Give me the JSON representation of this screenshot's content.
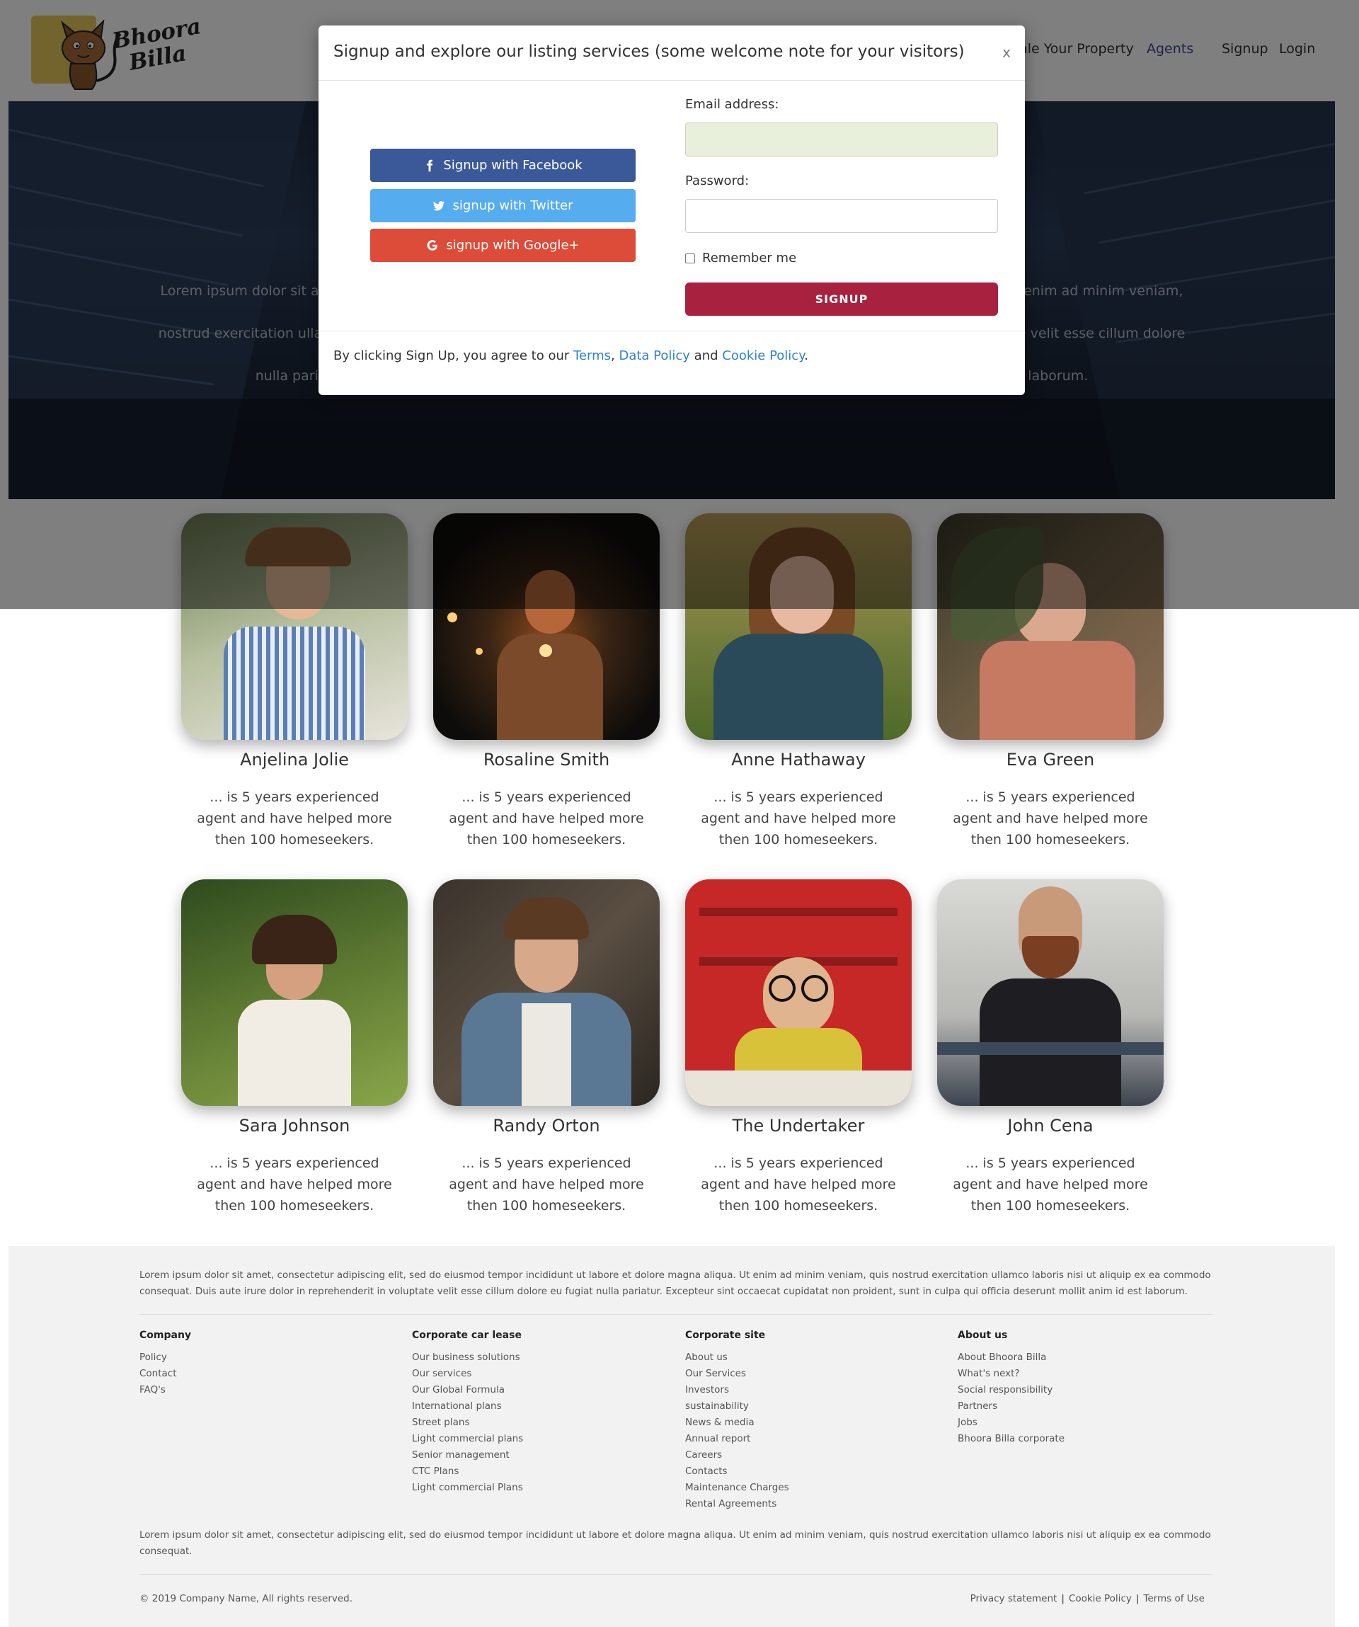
{
  "brand": {
    "logo_line1": "Bhoora",
    "logo_line2": "Billa"
  },
  "nav": {
    "sell": "Sale Your Property",
    "agents": "Agents",
    "signup": "Signup",
    "login": "Login"
  },
  "hero": {
    "text_line1": "Lorem ipsum dolor sit amet, consectetur adipiscing elit, sed do eiusmod tempor incididunt ut labore et dolore magna aliqua. Ut enim ad minim veniam, quis",
    "text_line2": "nostrud exercitation ullamco laboris nisi ut aliquip ex ea commodo consequat. Duis aute irure dolor in reprehenderit in voluptate velit esse cillum dolore eu fugiat",
    "text_line3": "nulla pariatur. Excepteur sint occaecat cupidatat non proident, sunt in culpa qui officia deserunt mollit anim id est laborum."
  },
  "modal": {
    "title": "Signup and explore our listing services (some welcome note for your visitors)",
    "close": "x",
    "facebook": "Signup with Facebook",
    "twitter": "signup with Twitter",
    "google": "signup with Google+",
    "email_label": "Email address:",
    "email_value": "",
    "password_label": "Password:",
    "password_value": "",
    "remember": "Remember me",
    "submit": "SIGNUP",
    "agree_prefix": "By clicking Sign Up, you agree to our ",
    "terms": "Terms",
    "comma": ", ",
    "data_policy": "Data Policy",
    "and": " and ",
    "cookie_policy": "Cookie Policy",
    "period": "."
  },
  "agents": [
    {
      "name": "Anjelina Jolie",
      "desc": "... is 5 years experienced agent and have helped more then 100 homeseekers."
    },
    {
      "name": "Rosaline Smith",
      "desc": "... is 5 years experienced agent and have helped more then 100 homeseekers."
    },
    {
      "name": "Anne Hathaway",
      "desc": "... is 5 years experienced agent and have helped more then 100 homeseekers."
    },
    {
      "name": "Eva Green",
      "desc": "... is 5 years experienced agent and have helped more then 100 homeseekers."
    },
    {
      "name": "Sara Johnson",
      "desc": "... is 5 years experienced agent and have helped more then 100 homeseekers."
    },
    {
      "name": "Randy Orton",
      "desc": "... is 5 years experienced agent and have helped more then 100 homeseekers."
    },
    {
      "name": "The Undertaker",
      "desc": "... is 5 years experienced agent and have helped more then 100 homeseekers."
    },
    {
      "name": "John Cena",
      "desc": "... is 5 years experienced agent and have helped more then 100 homeseekers."
    }
  ],
  "footer": {
    "para1": "Lorem ipsum dolor sit amet, consectetur adipiscing elit, sed do eiusmod tempor incididunt ut labore et dolore magna aliqua. Ut enim ad minim veniam, quis nostrud exercitation ullamco laboris nisi ut aliquip ex ea commodo consequat. Duis aute irure dolor in reprehenderit in voluptate velit esse cillum dolore eu fugiat nulla pariatur. Excepteur sint occaecat cupidatat non proident, sunt in culpa qui officia deserunt mollit anim id est laborum.",
    "columns": [
      {
        "heading": "Company",
        "links": [
          "Policy",
          "Contact",
          "FAQ's"
        ]
      },
      {
        "heading": "Corporate car lease",
        "links": [
          "Our business solutions",
          "Our services",
          "Our Global Formula",
          "International plans",
          "Street plans",
          "Light commercial plans",
          "Senior management",
          "CTC Plans",
          "Light commercial Plans"
        ]
      },
      {
        "heading": "Corporate site",
        "links": [
          "About us",
          "Our Services",
          "Investors",
          "sustainability",
          "News & media",
          "Annual report",
          "Careers",
          "Contacts",
          "Maintenance Charges",
          "Rental Agreements"
        ]
      },
      {
        "heading": "About us",
        "links": [
          "About Bhoora Billa",
          "What's next?",
          "Social responsibility",
          "Partners",
          "Jobs",
          "Bhoora Billa corporate"
        ]
      }
    ],
    "para2": "Lorem ipsum dolor sit amet, consectetur adipiscing elit, sed do eiusmod tempor incididunt ut labore et dolore magna aliqua. Ut enim ad minim veniam, quis nostrud exercitation ullamco laboris nisi ut aliquip ex ea commodo consequat.",
    "copyright": "© 2019 Company Name, All rights reserved.",
    "privacy": "Privacy statement",
    "cookie": "Cookie Policy",
    "terms": "Terms of Use",
    "separator": "|"
  }
}
